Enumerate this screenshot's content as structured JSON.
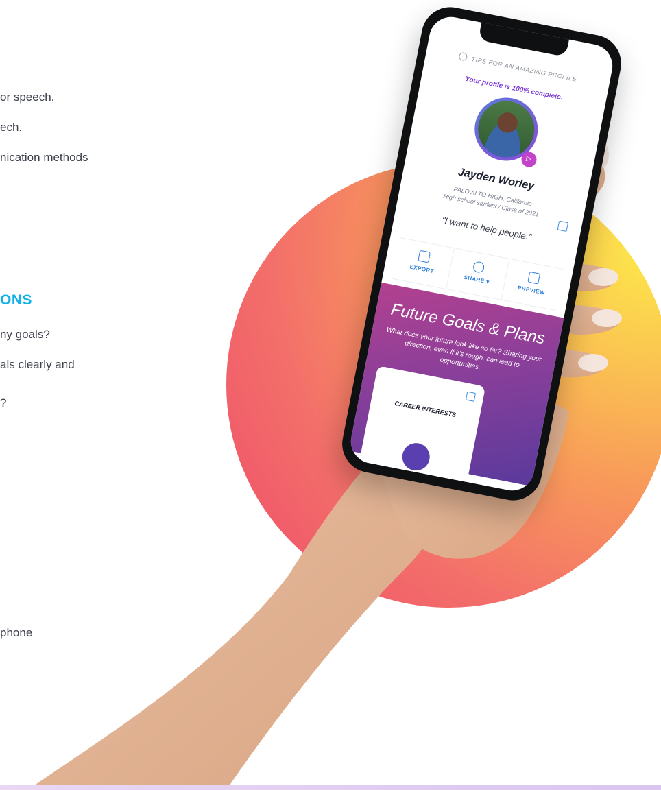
{
  "left_text": {
    "line1": "or speech.",
    "line2": "ech.",
    "line3": "nication methods",
    "heading": "ONS",
    "line4": "ny goals?",
    "line5": "als clearly and",
    "line6": "?",
    "line7": "phone"
  },
  "phone_screen": {
    "tips_label": "TIPS FOR AN AMAZING PROFILE",
    "completion": "Your profile is 100% complete.",
    "student_name": "Jayden Worley",
    "school": "PALO ALTO HIGH, California",
    "grade": "High school student / Class of 2021",
    "quote": "\"I want to help people.\"",
    "actions": [
      "EXPORT",
      "SHARE ▾",
      "PREVIEW"
    ],
    "goals_title": "Future Goals & Plans",
    "goals_subtitle": "What does your future look like so far? Sharing your direction, even if it's rough, can lead to opportunities.",
    "career_label": "CAREER INTERESTS",
    "play_symbol": "▷"
  },
  "colors": {
    "heading_blue": "#10b2e6",
    "circle_yellow": "#fde84a",
    "circle_pink": "#ee4a6a",
    "accent_purple": "#7b3bd8",
    "link_blue": "#2f7fd9"
  }
}
